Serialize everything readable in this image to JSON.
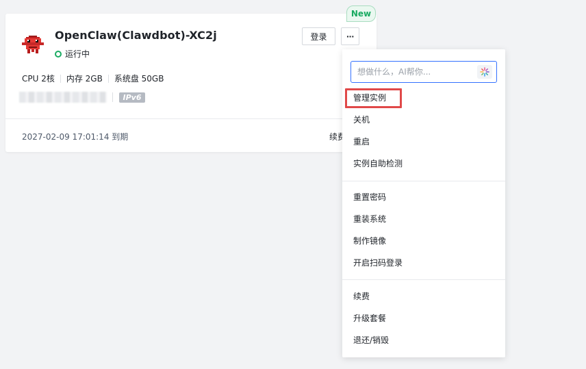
{
  "instance": {
    "name": "OpenClaw(Clawdbot)-XC2j",
    "status": "运行中",
    "status_color": "#1aab62",
    "login_label": "登录",
    "more_label": "···",
    "new_badge": "New",
    "specs": [
      "CPU 2核",
      "内存 2GB",
      "系统盘 50GB"
    ],
    "ipv6_label": "IPv6",
    "expire_text": "2027-02-09 17:01:14 到期",
    "renew_label": "续费"
  },
  "menu": {
    "search_placeholder": "想做什么，AI帮你...",
    "items": [
      "管理实例",
      "关机",
      "重启",
      "实例自助检测",
      "重置密码",
      "重装系统",
      "制作镜像",
      "开启扫码登录",
      "续费",
      "升级套餐",
      "退还/销毁"
    ],
    "highlight_color": "#e04848"
  },
  "colors": {
    "accent": "#3370ff",
    "page_bg": "#f2f3f5"
  }
}
